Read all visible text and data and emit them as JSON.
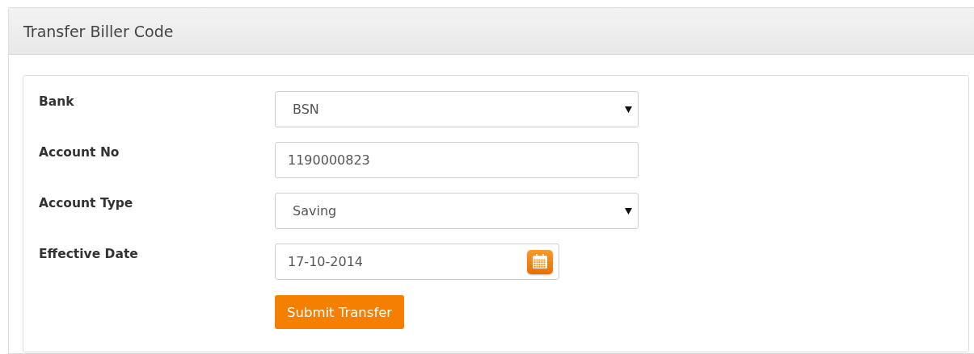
{
  "panel": {
    "title": "Transfer Biller Code"
  },
  "form": {
    "fields": [
      {
        "label": "Bank",
        "kind": "select",
        "value": "BSN"
      },
      {
        "label": "Account No",
        "kind": "text",
        "value": "1190000823"
      },
      {
        "label": "Account Type",
        "kind": "select",
        "value": "Saving"
      },
      {
        "label": "Effective Date",
        "kind": "date",
        "value": "17-10-2014"
      }
    ],
    "submit": "Submit Transfer"
  }
}
